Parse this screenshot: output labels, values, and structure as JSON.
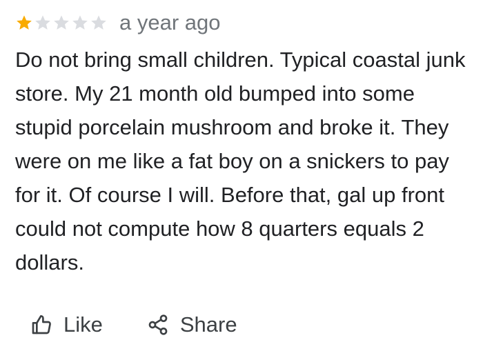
{
  "review": {
    "rating": 1,
    "max_rating": 5,
    "time_ago": "a year ago",
    "text": "Do not bring small children. Typical coastal junk store. My 21 month old bumped into some stupid porcelain mushroom and broke it. They were on me like a fat boy on a snickers to pay for it. Of course I will. Before that, gal up front could not compute how 8 quarters equals 2 dollars."
  },
  "actions": {
    "like_label": "Like",
    "like_icon": "thumbs-up-icon",
    "share_label": "Share",
    "share_icon": "share-icon"
  },
  "colors": {
    "star_filled": "#f9ab00",
    "star_empty": "#dadce0",
    "text": "#202124",
    "secondary_text": "#70757a",
    "action_text": "#3c4043"
  }
}
